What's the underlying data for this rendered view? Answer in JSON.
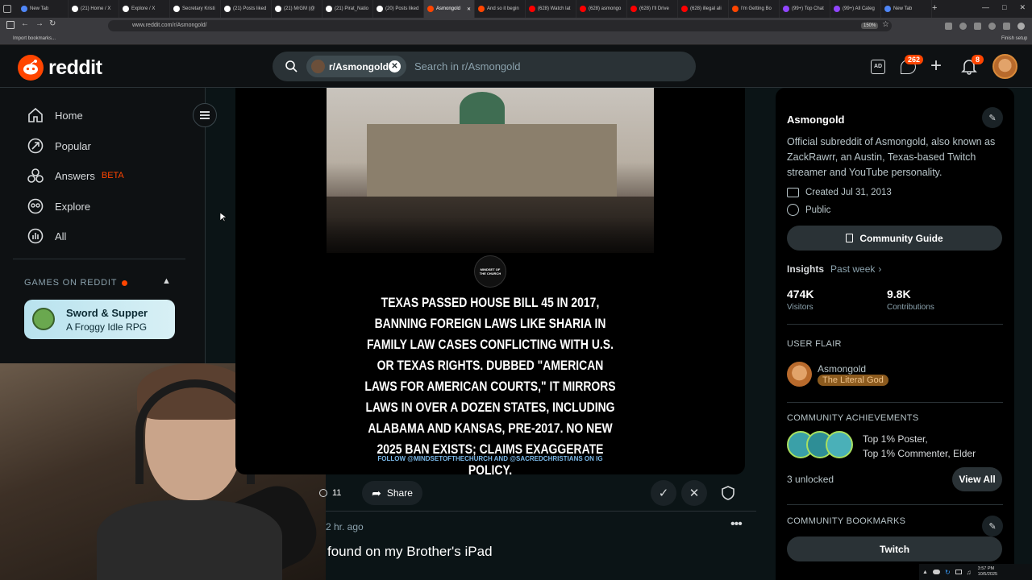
{
  "browser": {
    "tabs": [
      {
        "label": "New Tab",
        "color": "#4f86f7",
        "active": false
      },
      {
        "label": "(21) Home / X",
        "color": "#ffffff",
        "active": false
      },
      {
        "label": "Explore / X",
        "color": "#ffffff",
        "active": false
      },
      {
        "label": "Secretary Kristi",
        "color": "#ffffff",
        "active": false
      },
      {
        "label": "(21) Posts liked",
        "color": "#ffffff",
        "active": false
      },
      {
        "label": "(21) MrGM (@",
        "color": "#ffffff",
        "active": false
      },
      {
        "label": "(21) Pirat_Natio",
        "color": "#ffffff",
        "active": false
      },
      {
        "label": "(20) Posts liked",
        "color": "#ffffff",
        "active": false
      },
      {
        "label": "Asmongold",
        "color": "#ff4500",
        "active": true
      },
      {
        "label": "And so it begin",
        "color": "#ff4500",
        "active": false
      },
      {
        "label": "(628) Watch lat",
        "color": "#ff0000",
        "active": false
      },
      {
        "label": "(628) asmongo",
        "color": "#ff0000",
        "active": false
      },
      {
        "label": "(628) I'll Drive",
        "color": "#ff0000",
        "active": false
      },
      {
        "label": "(628) illegal ali",
        "color": "#ff0000",
        "active": false
      },
      {
        "label": "I'm Getting Bo",
        "color": "#ff4500",
        "active": false
      },
      {
        "label": "(99+) Top Chat",
        "color": "#9146ff",
        "active": false
      },
      {
        "label": "(99+) All Categ",
        "color": "#9146ff",
        "active": false
      },
      {
        "label": "New Tab",
        "color": "#4f86f7",
        "active": false
      }
    ],
    "url": "www.reddit.com/r/Asmongold/",
    "zoom": "150%",
    "bookmarks_label": "Import bookmarks...",
    "finish_setup": "Finish setup"
  },
  "header": {
    "logo_text": "reddit",
    "search_chip": "r/Asmongold",
    "search_placeholder": "Search in r/Asmongold",
    "chat_badge": "262",
    "notif_badge": "8"
  },
  "sidebar": {
    "items": [
      {
        "label": "Home",
        "icon": "home-icon"
      },
      {
        "label": "Popular",
        "icon": "popular-icon"
      },
      {
        "label": "Answers",
        "icon": "answers-icon",
        "badge": "BETA"
      },
      {
        "label": "Explore",
        "icon": "explore-icon"
      },
      {
        "label": "All",
        "icon": "all-icon"
      }
    ],
    "games_header": "GAMES ON REDDIT",
    "game": {
      "title": "Sword & Supper",
      "subtitle": "A Froggy Idle RPG"
    }
  },
  "post": {
    "logo_text": "MINDSET OF THE CHURCH",
    "caption": "TEXAS PASSED HOUSE BILL 45 IN 2017, BANNING FOREIGN LAWS LIKE SHARIA IN FAMILY LAW CASES CONFLICTING WITH U.S. OR TEXAS RIGHTS. DUBBED \"AMERICAN LAWS FOR AMERICAN COURTS,\" IT MIRRORS LAWS IN OVER A DOZEN STATES, INCLUDING ALABAMA AND KANSAS, PRE-2017. NO NEW 2025 BAN EXISTS; CLAIMS EXAGGERATE POLICY.",
    "footer": "FOLLOW @MINDSETOFTHECHURCH AND @SACREDCHRISTIANS ON IG",
    "comments": "11",
    "share_label": "Share"
  },
  "next_post": {
    "time": "2 hr. ago",
    "title": "found on my Brother's iPad"
  },
  "community": {
    "name": "Asmongold",
    "description": "Official subreddit of Asmongold, also known as ZackRawrr, an Austin, Texas-based Twitch streamer and YouTube personality.",
    "created": "Created Jul 31, 2013",
    "visibility": "Public",
    "guide_button": "Community Guide",
    "insights_label": "Insights",
    "insights_range": "Past week",
    "stats": [
      {
        "value": "474K",
        "label": "Visitors"
      },
      {
        "value": "9.8K",
        "label": "Contributions"
      }
    ],
    "user_flair_header": "USER FLAIR",
    "flair_user": "Asmongold",
    "flair_tag": "The Literal God",
    "achievements_header": "COMMUNITY ACHIEVEMENTS",
    "achievements_line1": "Top 1% Poster,",
    "achievements_line2": "Top 1% Commenter, Elder",
    "unlocked": "3 unlocked",
    "view_all": "View All",
    "bookmarks_header": "COMMUNITY BOOKMARKS",
    "bookmark_button": "Twitch"
  },
  "taskbar": {
    "time": "3:57 PM",
    "date": "10/5/2025"
  },
  "colors": {
    "reddit_orange": "#ff4500",
    "flair_bg": "#8b5a1e",
    "beta": "#ff4500"
  }
}
